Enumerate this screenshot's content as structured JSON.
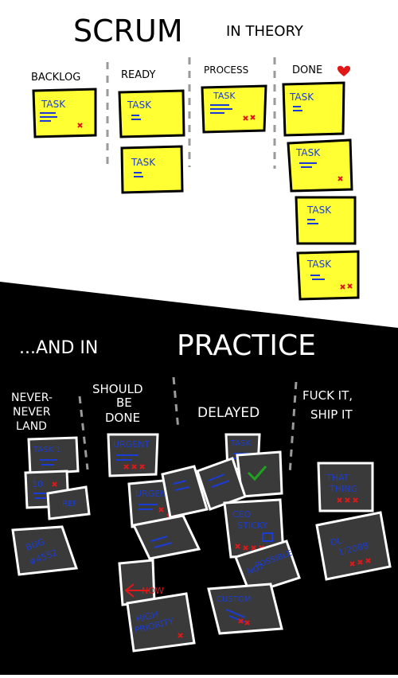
{
  "theory": {
    "title_main": "SCRUM",
    "title_sub": "IN THEORY",
    "columns": [
      "BACKLOG",
      "READY",
      "PROCESS",
      "DONE"
    ],
    "task_label": "TASK"
  },
  "practice": {
    "title_lead": "...AND IN",
    "title_main": "PRACTICE",
    "columns": [
      {
        "lines": [
          "NEVER-",
          "NEVER",
          "LAND"
        ]
      },
      {
        "lines": [
          "SHOULD",
          "BE",
          "DONE"
        ]
      },
      {
        "lines": [
          "DELAYED"
        ]
      },
      {
        "lines": [
          "FUCK IT,",
          "SHIP IT"
        ]
      }
    ],
    "notes": {
      "task1": "TASK 1",
      "n10": "10",
      "ref": "REF",
      "bug": "BUG",
      "bug_num": "#4552",
      "urgent1": "URGENT",
      "urgent2": "URGENT",
      "now": "NOW",
      "high1": "HIGH",
      "high2": "PRIORITY",
      "task_delayed": "TASK",
      "ceo1": "CEO",
      "ceo2": "STICKY",
      "not_possible1": "NOT",
      "not_possible2": "POSSIBLE",
      "custom": "CUSTOM",
      "that1": "THAT",
      "that2": "THING",
      "dl1": "DL.",
      "dl2": "1/2008"
    }
  },
  "colors": {
    "sticky_yellow": "#ffff33",
    "sticky_dark": "#3a3a3a",
    "ink_blue": "#1a3cd6",
    "mark_red": "#e01818",
    "heart_red": "#e01818",
    "check_green": "#1fa31f",
    "divider_gray": "#9a9a9a"
  }
}
